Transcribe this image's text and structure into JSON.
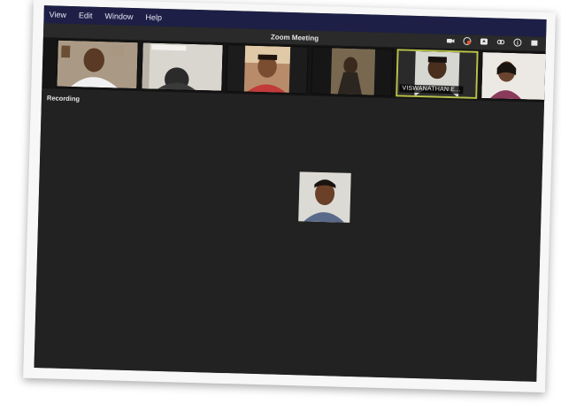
{
  "menu": {
    "items": [
      "View",
      "Edit",
      "Window",
      "Help"
    ]
  },
  "window": {
    "title": "Zoom Meeting",
    "icons": [
      "camera-icon",
      "record-icon",
      "share-icon",
      "link-icon",
      "info-icon",
      "stop-icon"
    ]
  },
  "participants": [
    {
      "name": "",
      "active": false
    },
    {
      "name": "",
      "active": false
    },
    {
      "name": "",
      "active": false
    },
    {
      "name": "",
      "active": false
    },
    {
      "name": "VISWANATHAN E...",
      "active": true
    },
    {
      "name": "",
      "active": false
    }
  ],
  "status": {
    "recording_label": "Recording"
  },
  "colors": {
    "menubar": "#1d1f46",
    "screen_bg": "#232323",
    "active_border": "#b8c24a"
  }
}
